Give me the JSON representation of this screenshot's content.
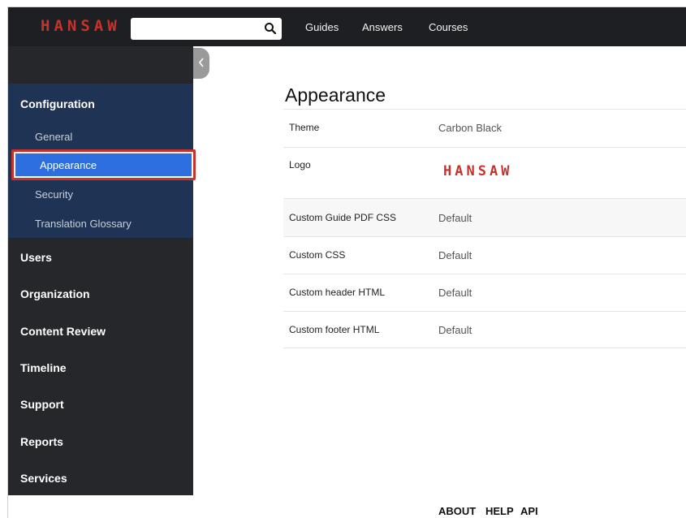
{
  "header": {
    "logo": "HANSAW",
    "search": {
      "placeholder": "",
      "value": ""
    },
    "nav": [
      "Guides",
      "Answers",
      "Courses"
    ]
  },
  "sidebar": {
    "configuration": {
      "title": "Configuration",
      "items": [
        "General",
        "Appearance",
        "Security",
        "Translation Glossary"
      ],
      "active": "Appearance"
    },
    "sections": [
      "Users",
      "Organization",
      "Content Review",
      "Timeline",
      "Support",
      "Reports",
      "Services"
    ]
  },
  "main": {
    "title": "Appearance",
    "rows": [
      {
        "label": "Theme",
        "value": "Carbon Black"
      },
      {
        "label": "Logo",
        "value": "HANSAW"
      },
      {
        "label": "Custom Guide PDF CSS",
        "value": "Default"
      },
      {
        "label": "Custom CSS",
        "value": "Default"
      },
      {
        "label": "Custom header HTML",
        "value": "Default"
      },
      {
        "label": "Custom footer HTML",
        "value": "Default"
      }
    ]
  },
  "footer": {
    "links": [
      "ABOUT",
      "HELP",
      "API"
    ]
  },
  "colors": {
    "topbar": "#1e1f22",
    "sidebar": "#25272b",
    "config_group": "#1f3354",
    "active_item": "#2e6fe0",
    "highlight_border": "#c8322d",
    "logo": "#c8322d"
  },
  "icons": {
    "search": "search-icon",
    "collapse": "chevron-left-icon"
  }
}
